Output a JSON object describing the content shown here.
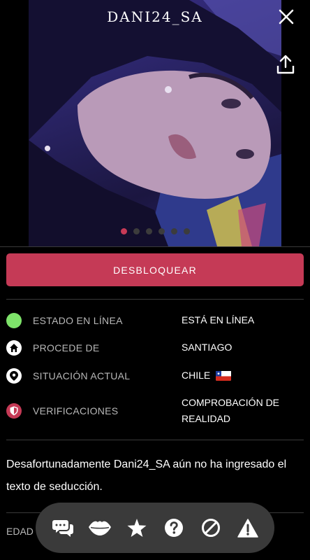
{
  "profile": {
    "username": "DANI24_SA",
    "photo_count": 6,
    "active_photo_index": 0
  },
  "actions": {
    "unlock_label": "DESBLOQUEAR"
  },
  "info": {
    "online_status": {
      "label": "ESTADO EN LÍNEA",
      "value": "ESTÁ EN LÍNEA",
      "color": "#7ee36a"
    },
    "origin": {
      "label": "PROCEDE DE",
      "value": "SANTIAGO"
    },
    "location": {
      "label": "SITUACIÓN ACTUAL",
      "value": "CHILE"
    },
    "verifications": {
      "label": "VERIFICACIONES",
      "value_line1": "COMPROBACIÓN DE",
      "value_line2": "REALIDAD"
    }
  },
  "description": "Desafortunadamente Dani24_SA aún no ha ingresado el texto de seducción.",
  "age_label": "EDAD",
  "bottom_bar": {
    "icons": [
      "chat-bubbles-icon",
      "kiss-lips-icon",
      "star-icon",
      "help-icon",
      "block-icon",
      "warning-icon"
    ]
  },
  "colors": {
    "accent": "#c53a56",
    "background": "#000000",
    "online": "#7ee36a"
  }
}
